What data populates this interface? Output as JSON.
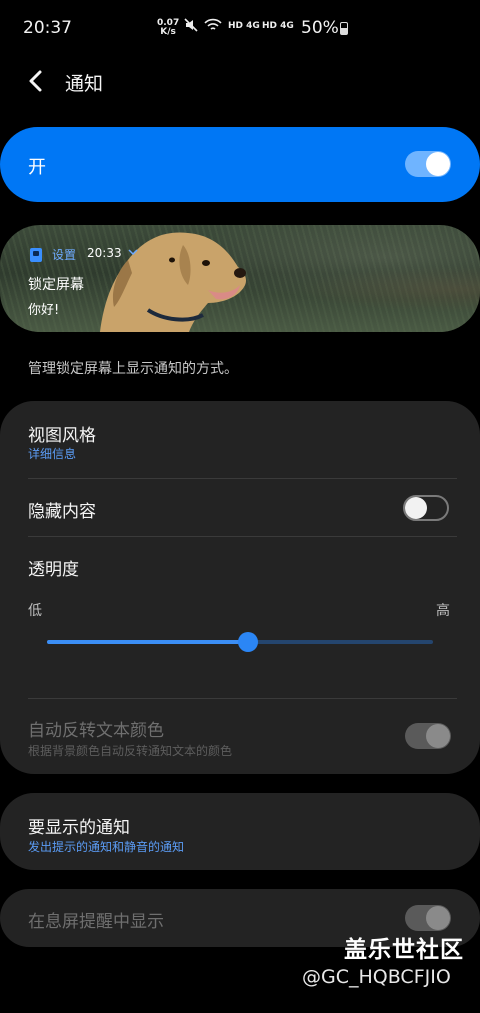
{
  "status_bar": {
    "time": "20:37",
    "net_speed_value": "0.07",
    "net_speed_unit": "K/s",
    "signal1": "HD 4G",
    "signal2": "HD 4G",
    "battery": "50%"
  },
  "header": {
    "title": "通知"
  },
  "master_switch": {
    "label": "开",
    "on": true
  },
  "preview": {
    "app_name": "设置",
    "time": "20:33",
    "title": "锁定屏幕",
    "body": "你好!"
  },
  "description": "管理锁定屏幕上显示通知的方式。",
  "settings": {
    "view_style": {
      "title": "视图风格",
      "subtitle": "详细信息"
    },
    "hide_content": {
      "title": "隐藏内容",
      "on": false
    },
    "transparency": {
      "title": "透明度",
      "low_label": "低",
      "high_label": "高",
      "value_percent": 52
    },
    "auto_invert": {
      "title": "自动反转文本颜色",
      "subtitle": "根据背景颜色自动反转通知文本的颜色",
      "on": true,
      "enabled": false
    },
    "notifications_to_show": {
      "title": "要显示的通知",
      "subtitle": "发出提示的通知和静音的通知"
    },
    "aod": {
      "title": "在息屏提醒中显示",
      "on": true,
      "enabled": false
    }
  },
  "watermark": {
    "line1": "盖乐世社区",
    "line2": "@GC_HQBCFJIO"
  },
  "colors": {
    "accent": "#0077f5",
    "link": "#5b9cf5",
    "card_bg": "#232323"
  }
}
